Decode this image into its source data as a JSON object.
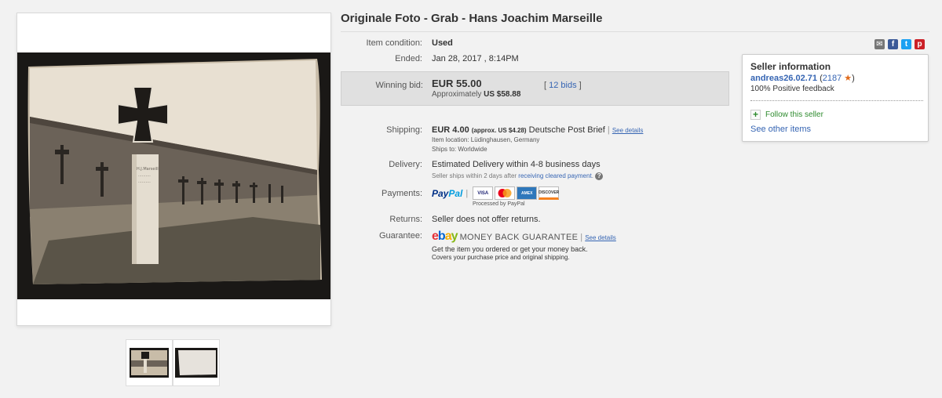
{
  "listing": {
    "title": "Originale Foto - Grab - Hans Joachim Marseille"
  },
  "details": {
    "condition_label": "Item condition:",
    "condition_value": "Used",
    "ended_label": "Ended:",
    "ended_value": "Jan 28, 2017 , 8:14PM",
    "bid_label": "Winning bid:",
    "bid_price": "EUR 55.00",
    "bid_approx_prefix": "Approximately",
    "bid_approx_value": "US $58.88",
    "bids_open": "[",
    "bids_link": "12 bids",
    "bids_close": "]",
    "shipping_label": "Shipping:",
    "shipping_price": "EUR 4.00",
    "shipping_approx": "(approx. US $4.28)",
    "shipping_service": "Deutsche Post Brief",
    "shipping_sep": "|",
    "shipping_details_link": "See details",
    "item_location": "Item location:  Lüdinghausen, Germany",
    "ships_to": "Ships to:  Worldwide",
    "delivery_label": "Delivery:",
    "delivery_value": "Estimated Delivery within 4-8 business days",
    "delivery_note": "Seller ships within 2 days after",
    "delivery_link": "receiving cleared payment",
    "delivery_note_end": ".",
    "payments_label": "Payments:",
    "paypal_a": "Pay",
    "paypal_b": "Pal",
    "processed_by": "Processed by PayPal",
    "cards": [
      "VISA",
      "MC",
      "AMEX",
      "DISCOVER"
    ],
    "returns_label": "Returns:",
    "returns_value": "Seller does not offer returns.",
    "guarantee_label": "Guarantee:",
    "mbg_text": "MONEY BACK GUARANTEE",
    "mbg_sep": "|",
    "mbg_link": "See details",
    "mbg_line1": "Get the item you ordered or get your money back.",
    "mbg_line2": "Covers your purchase price and original shipping."
  },
  "seller": {
    "heading": "Seller information",
    "username": "andreas26.02.71",
    "score_open": "(",
    "score": "2187",
    "score_close": ")",
    "feedback": "100% Positive feedback",
    "follow": "Follow this seller",
    "other_items": "See other items"
  },
  "colors": {
    "link": "#3665b3",
    "bid_box": "#e0e0e0",
    "star": "#e06a1b"
  },
  "icons": [
    "email-icon",
    "facebook-icon",
    "twitter-icon",
    "pinterest-icon",
    "star-icon",
    "plus-icon",
    "help-icon"
  ]
}
